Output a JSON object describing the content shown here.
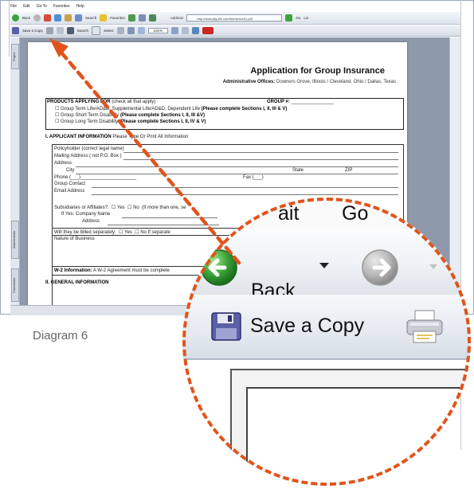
{
  "browser": {
    "menu": [
      "File",
      "Edit",
      "Go To",
      "Favorites",
      "Help"
    ],
    "toolbar": {
      "back_label": "Back",
      "search_label": "Search",
      "favorites_label": "Favorites",
      "address_label": "Address",
      "address_value": "http://www.pfg-life.com/forms/xxx01.pdf",
      "go_label": "Go",
      "links_label": "Lin"
    },
    "pdf_toolbar": {
      "save_copy_label": "Save a Copy",
      "search_label": "Search",
      "select_label": "Select",
      "zoom_value": "101%"
    },
    "side_tabs": [
      "Pages",
      "Attachments",
      "Comments"
    ]
  },
  "document": {
    "title": "Application for Group Insurance",
    "offices_label": "Administrative Offices:",
    "offices_value": "Downers Grove, Illinois / Cleveland, Ohio / Dallas, Texas",
    "products_heading": "PRODUCTS APPLYING FOR",
    "products_hint": "(check all that apply):",
    "group_no_label": "GROUP #:",
    "products": [
      {
        "text": "Group Term Life/AD&D, Supplemental Life/AD&D, Dependent Life",
        "bold": "(Please complete Sections I, II, III & V)"
      },
      {
        "text": "Group Short Term Disability",
        "bold": "(Please complete Sections I, II, III &V)"
      },
      {
        "text": "Group Long Term Disability",
        "bold": "(Please complete Sections I, II, IV & V)"
      }
    ],
    "section1_heading": "I. APPLICANT INFORMATION",
    "section1_hint": "Please Type Or Print All Information",
    "fields": [
      "Policyholder (correct legal name)",
      "Mailing Address ( not P.O. Box )",
      "Address",
      "City",
      "State",
      "ZIP",
      "Phone",
      "Fax",
      "Group Contact",
      "Email Address"
    ],
    "subsidiaries": "Subsidiaries or Affiliates?:",
    "yes": "Yes",
    "no": "No",
    "if_more": "(If more than one, se",
    "if_yes_company": "If Yes: Company Name",
    "address_short": "Address",
    "billed_separately": "Will they be billed separately:",
    "if_separate": "If separate",
    "nature_business": "Nature of Business",
    "w2_label": "W-2 Information:",
    "w2_text": "A W-2 Agreement must be complete",
    "section2_heading": "II. GENERAL INFORMATION"
  },
  "caption": "Diagram 6",
  "magnified": {
    "top_partial_left": "ait",
    "top_partial_right": "Go",
    "back_label": "Back",
    "save_copy_label": "Save a Copy"
  },
  "colors": {
    "accent_dashed": "#e0541b",
    "back_button_green": "#3aa53a",
    "forward_button_gray": "#b7b7b7",
    "save_icon_purple": "#5a5fa8"
  }
}
